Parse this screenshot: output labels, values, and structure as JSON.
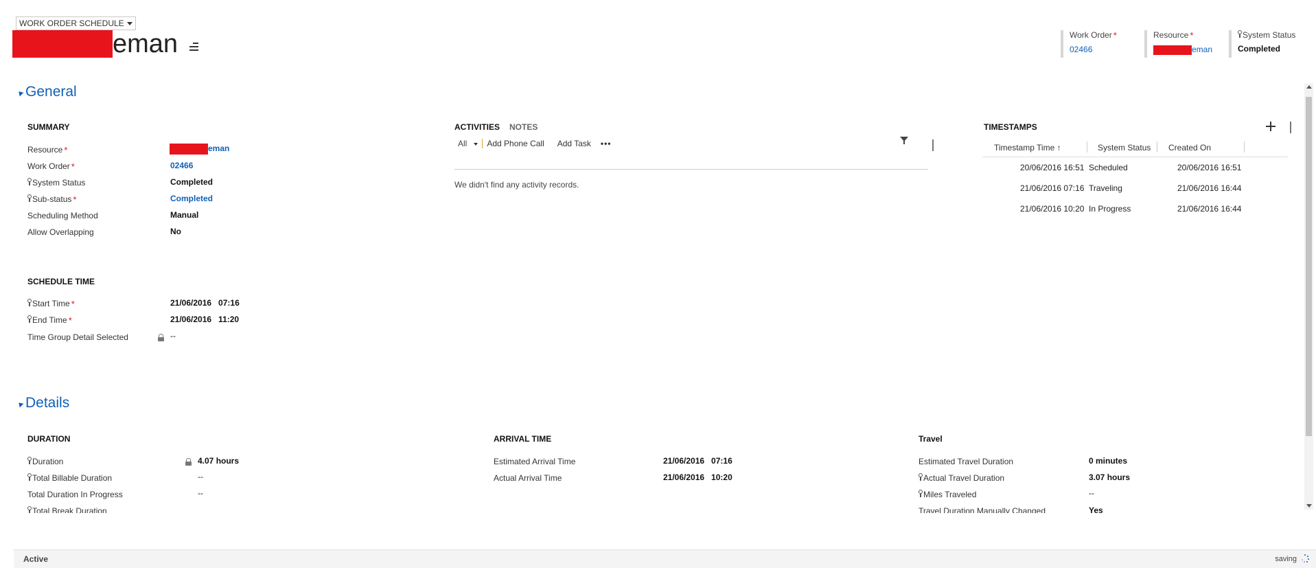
{
  "form_selector": {
    "label": "WORK ORDER SCHEDULE"
  },
  "record": {
    "title_suffix": "eman"
  },
  "header_fields": [
    {
      "label": "Work Order",
      "value": "02466"
    },
    {
      "label": "Resource",
      "value": "eman"
    },
    {
      "label": "System Status",
      "value": "Completed"
    }
  ],
  "general": {
    "title": "General",
    "summary": {
      "header": "SUMMARY",
      "fields": [
        {
          "label": "Resource",
          "value": "eman"
        },
        {
          "label": "Work Order",
          "value": "02466"
        },
        {
          "label": "System Status",
          "value": "Completed"
        },
        {
          "label": "Sub-status",
          "value": "Completed"
        },
        {
          "label": "Scheduling Method",
          "value": "Manual"
        },
        {
          "label": "Allow Overlapping",
          "value": "No"
        }
      ]
    },
    "schedule_time": {
      "header": "SCHEDULE TIME",
      "fields": [
        {
          "label": "Start Time",
          "value": "21/06/2016   07:16"
        },
        {
          "label": "End Time",
          "value": "21/06/2016   11:20"
        },
        {
          "label": "Time Group Detail Selected",
          "value": "--"
        }
      ]
    },
    "activities": {
      "tabs": [
        "ACTIVITIES",
        "NOTES"
      ],
      "filter": "All",
      "commands": [
        "Add Phone Call",
        "Add Task"
      ],
      "empty_message": "We didn't find any activity records."
    },
    "timestamps": {
      "header": "TIMESTAMPS",
      "columns": [
        "Timestamp Time",
        "System Status",
        "Created On"
      ],
      "rows": [
        [
          "20/06/2016 16:51",
          "Scheduled",
          "20/06/2016 16:51"
        ],
        [
          "21/06/2016 07:16",
          "Traveling",
          "21/06/2016 16:44"
        ],
        [
          "21/06/2016 10:20",
          "In Progress",
          "21/06/2016 16:44"
        ]
      ]
    }
  },
  "details": {
    "title": "Details",
    "duration": {
      "header": "DURATION",
      "fields": [
        {
          "label": "Duration",
          "value": "4.07 hours"
        },
        {
          "label": "Total Billable Duration",
          "value": "--"
        },
        {
          "label": "Total Duration In Progress",
          "value": "--"
        },
        {
          "label": "Total Break Duration",
          "value": ""
        }
      ]
    },
    "arrival_time": {
      "header": "ARRIVAL TIME",
      "fields": [
        {
          "label": "Estimated Arrival Time",
          "value": "21/06/2016   07:16"
        },
        {
          "label": "Actual Arrival Time",
          "value": "21/06/2016   10:20"
        }
      ]
    },
    "travel": {
      "header": "Travel",
      "fields": [
        {
          "label": "Estimated Travel Duration",
          "value": "0 minutes"
        },
        {
          "label": "Actual Travel Duration",
          "value": "3.07 hours"
        },
        {
          "label": "Miles Traveled",
          "value": "--"
        },
        {
          "label": "Travel Duration Manually Changed",
          "value": "Yes"
        }
      ]
    }
  },
  "footer": {
    "status": "Active",
    "saving": "saving"
  },
  "colors": {
    "accent": "#1160b7",
    "required": "#e8141c",
    "redaction": "#e8141c"
  }
}
